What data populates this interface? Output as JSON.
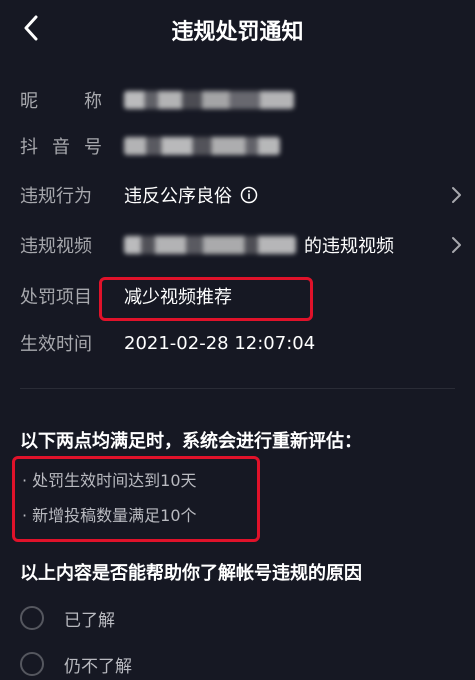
{
  "header": {
    "title": "违规处罚通知"
  },
  "details": {
    "nickname_label_chars": [
      "昵",
      "称"
    ],
    "douyin_id_label_chars": [
      "抖",
      "音",
      "号"
    ],
    "violation_label": "违规行为",
    "violation_value": "违反公序良俗",
    "video_label": "违规视频",
    "video_suffix": "的违规视频",
    "penalty_label": "处罚项目",
    "penalty_value": "减少视频推荐",
    "effective_label": "生效时间",
    "effective_value": "2021-02-28 12:07:04"
  },
  "reassess": {
    "title": "以下两点均满足时，系统会进行重新评估：",
    "conditions": [
      "· 处罚生效时间达到10天",
      "· 新增投稿数量满足10个"
    ]
  },
  "feedback": {
    "question": "以上内容是否能帮助你了解帐号违规的原因",
    "options": [
      "已了解",
      "仍不了解"
    ]
  },
  "colors": {
    "background": "#161823",
    "highlight_box": "#e0122a",
    "label": "#a7a8ad",
    "value": "#ffffff"
  },
  "icons": [
    "back-arrow-icon",
    "info-icon",
    "chevron-right-icon"
  ]
}
